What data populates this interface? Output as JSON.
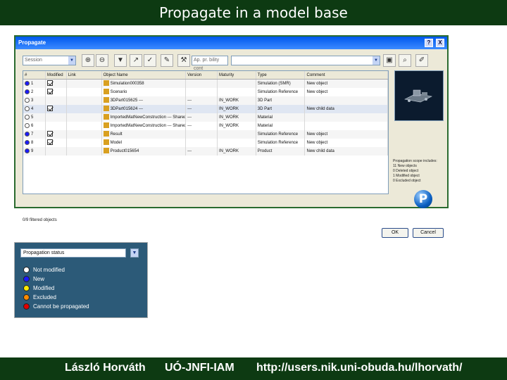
{
  "slide": {
    "title": "Propagate in a model base",
    "footer": {
      "author": "László Horváth",
      "institute": "UÓ-JNFI-IAM",
      "url": "http://users.nik.uni-obuda.hu/lhorvath/"
    }
  },
  "dialog": {
    "title": "Propagate",
    "title_buttons": [
      "?",
      "X"
    ],
    "toolbar": {
      "scope_value": "Session",
      "filter_value": "Ap. pr. bility cont"
    },
    "columns": [
      "#",
      "Modified",
      "Link",
      "Object Name",
      "Version",
      "Maturity",
      "Type",
      "Comment"
    ],
    "rows": [
      {
        "no": "1",
        "status": "New",
        "modified": true,
        "name": "Simulation000358",
        "version": "",
        "maturity": "",
        "type": "Simulation (SMR)",
        "comment": "New object"
      },
      {
        "no": "2",
        "status": "New",
        "modified": true,
        "name": "Scenario",
        "version": "",
        "maturity": "",
        "type": "Simulation Reference",
        "comment": "New object"
      },
      {
        "no": "3",
        "status": "Not modified",
        "modified": false,
        "name": "3DPart015625 ---",
        "version": "---",
        "maturity": "IN_WORK",
        "type": "3D Part",
        "comment": ""
      },
      {
        "no": "4",
        "status": "Not modified",
        "modified": true,
        "name": "3DPart015624 ---",
        "version": "---",
        "maturity": "IN_WORK",
        "type": "3D Part",
        "comment": "New child data"
      },
      {
        "no": "5",
        "status": "Not modified",
        "modified": false,
        "name": "ImportedMatNewConstruction --- Shared",
        "version": "---",
        "maturity": "IN_WORK",
        "type": "Material",
        "comment": ""
      },
      {
        "no": "6",
        "status": "Not modified",
        "modified": false,
        "name": "ImportedMatNewConstruction --- Shared",
        "version": "---",
        "maturity": "IN_WORK",
        "type": "Material",
        "comment": ""
      },
      {
        "no": "7",
        "status": "New",
        "modified": true,
        "name": "Result",
        "version": "",
        "maturity": "",
        "type": "Simulation Reference",
        "comment": "New object"
      },
      {
        "no": "8",
        "status": "New",
        "modified": true,
        "name": "Model",
        "version": "",
        "maturity": "",
        "type": "Simulation Reference",
        "comment": "New object"
      },
      {
        "no": "9",
        "status": "New",
        "modified": false,
        "name": "Product015654",
        "version": "---",
        "maturity": "IN_WORK",
        "type": "Product",
        "comment": "New child data"
      }
    ],
    "preview_scope": {
      "heading": "Propagation scope includes:",
      "items": [
        "11  New objects",
        "0  Deleted object",
        "1  Modified object",
        "0  Excluded object"
      ]
    },
    "status_text": "0/9  filtered objects",
    "ok_label": "OK",
    "cancel_label": "Cancel"
  },
  "legend": {
    "combo_value": "Propagation status",
    "items": [
      {
        "label": "Not modified",
        "color": "#ffffff"
      },
      {
        "label": "New",
        "color": "#1a1aff"
      },
      {
        "label": "Modified",
        "color": "#ffe800"
      },
      {
        "label": "Excluded",
        "color": "#ff8a00"
      },
      {
        "label": "Cannot be propagated",
        "color": "#e00000"
      }
    ]
  },
  "colors": {
    "slide_bar": "#0d3a12",
    "dialog_title": "#0058ee",
    "legend_panel": "#2c5a78",
    "status_new": "#1a1aff",
    "status_not_modified": "#ffffff"
  }
}
